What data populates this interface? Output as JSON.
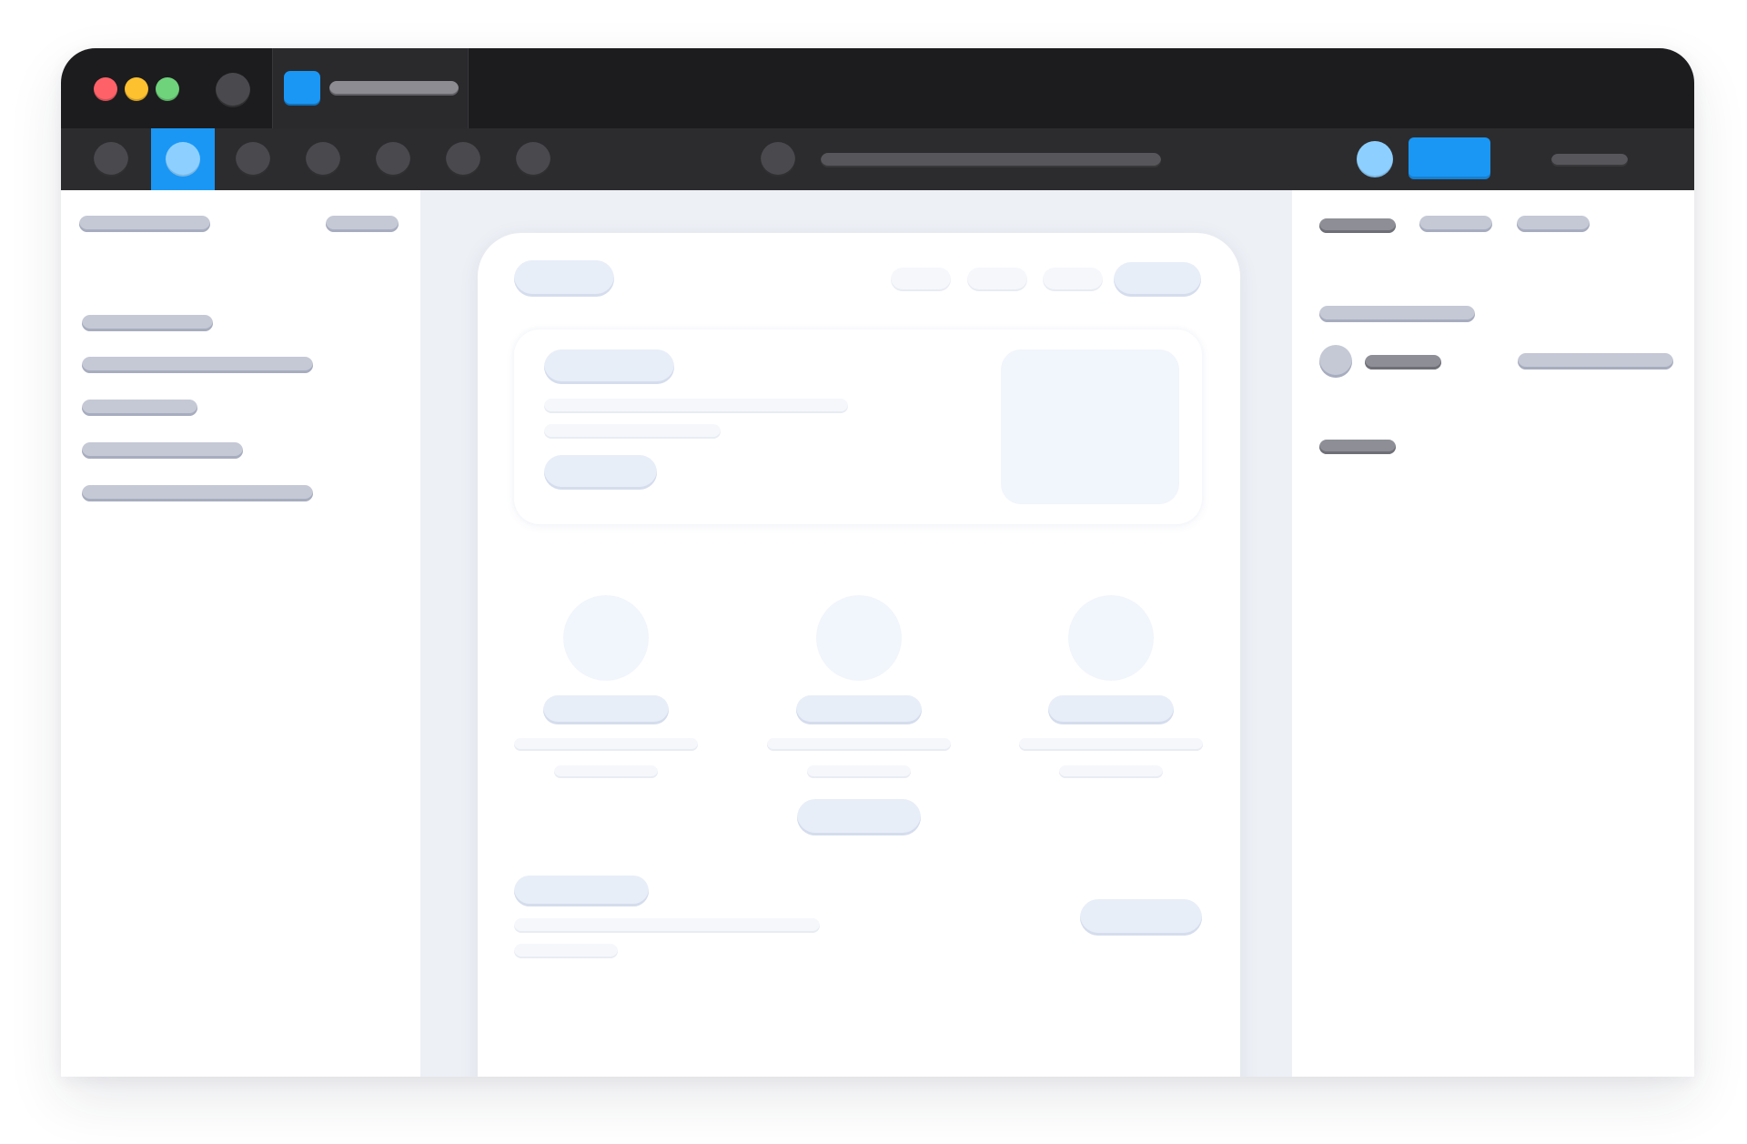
{
  "colors": {
    "accent": "#1a97f5",
    "close": "#fe6168",
    "minimize": "#fdc02f",
    "maximize": "#6fd37c"
  },
  "titlebar": {
    "traffic_lights": [
      "close",
      "minimize",
      "maximize"
    ],
    "history_icon": "circle-icon",
    "tab": {
      "favicon": "app-icon",
      "title": ""
    }
  },
  "toolbar": {
    "tools": [
      {
        "icon": "tool-1-icon",
        "active": false
      },
      {
        "icon": "tool-2-icon",
        "active": true
      },
      {
        "icon": "tool-3-icon",
        "active": false
      },
      {
        "icon": "tool-4-icon",
        "active": false
      },
      {
        "icon": "tool-5-icon",
        "active": false
      },
      {
        "icon": "tool-6-icon",
        "active": false
      },
      {
        "icon": "tool-7-icon",
        "active": false
      }
    ],
    "search_icon": "search-icon",
    "address": "",
    "avatar_icon": "avatar-icon",
    "primary_button_label": "",
    "menu_label": ""
  },
  "sidebar": {
    "header_label": "",
    "header_action_label": "",
    "items": [
      "",
      "",
      "",
      "",
      ""
    ]
  },
  "artboard": {
    "nav": {
      "logo": "",
      "links": [
        "",
        "",
        ""
      ],
      "cta": ""
    },
    "hero": {
      "badge": "",
      "headline": "",
      "subline": "",
      "button": ""
    },
    "features": [
      {
        "title": "",
        "line1": "",
        "line2": ""
      },
      {
        "title": "",
        "line1": "",
        "line2": ""
      },
      {
        "title": "",
        "line1": "",
        "line2": ""
      }
    ],
    "features_button": "",
    "footer": {
      "title": "",
      "line1": "",
      "line2": "",
      "button": ""
    }
  },
  "inspector": {
    "tabs": [
      "",
      "",
      ""
    ],
    "section_title": "",
    "property_label": "",
    "property_value": "",
    "section2_title": ""
  }
}
